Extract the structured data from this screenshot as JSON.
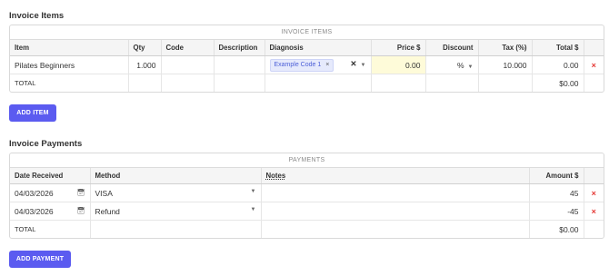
{
  "invoice_items": {
    "title": "Invoice Items",
    "caption": "INVOICE ITEMS",
    "headers": {
      "item": "Item",
      "qty": "Qty",
      "code": "Code",
      "description": "Description",
      "diagnosis": "Diagnosis",
      "price": "Price $",
      "discount": "Discount",
      "tax": "Tax (%)",
      "total": "Total $"
    },
    "row": {
      "item": "Pilates Beginners",
      "qty": "1.000",
      "code": "",
      "description": "",
      "diagnosis_tag": "Example Code 1",
      "price": "0.00",
      "discount": "%",
      "tax": "10.000",
      "total": "0.00"
    },
    "total_row": {
      "label": "TOTAL",
      "total": "$0.00"
    },
    "add_button": "ADD ITEM"
  },
  "invoice_payments": {
    "title": "Invoice Payments",
    "caption": "PAYMENTS",
    "headers": {
      "date": "Date Received",
      "method": "Method",
      "notes": "Notes",
      "amount": "Amount $"
    },
    "rows": [
      {
        "date": "04/03/2026",
        "method": "VISA",
        "notes": "",
        "amount": "45"
      },
      {
        "date": "04/03/2026",
        "method": "Refund",
        "notes": "",
        "amount": "-45"
      }
    ],
    "total_row": {
      "label": "TOTAL",
      "total": "$0.00"
    },
    "add_button": "ADD PAYMENT"
  },
  "icons": {
    "delete": "×",
    "clear": "✕",
    "caret": "▼",
    "calendar": "calendar-icon"
  },
  "colors": {
    "accent": "#5b5bf0",
    "delete": "#e53935",
    "price_highlight": "#fefbd9",
    "tag_bg": "#e6eafc"
  }
}
